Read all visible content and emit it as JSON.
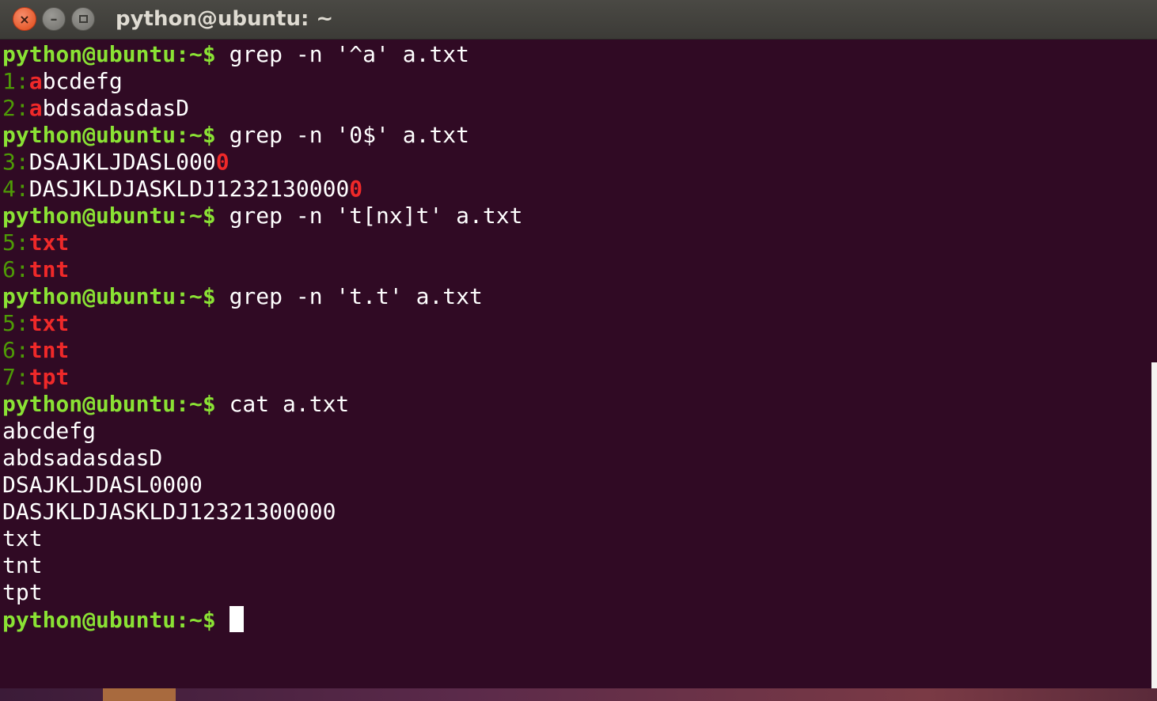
{
  "window": {
    "title": "python@ubuntu: ~",
    "close_glyph": "×",
    "minimize_glyph": "–"
  },
  "prompt": "python@ubuntu:~$",
  "lines": [
    {
      "type": "cmd",
      "cmd": " grep -n '^a' a.txt"
    },
    {
      "type": "match",
      "num": "1",
      "pre": "",
      "m": "a",
      "post": "bcdefg"
    },
    {
      "type": "match",
      "num": "2",
      "pre": "",
      "m": "a",
      "post": "bdsadasdasD"
    },
    {
      "type": "cmd",
      "cmd": " grep -n '0$' a.txt"
    },
    {
      "type": "match",
      "num": "3",
      "pre": "DSAJKLJDASL000",
      "m": "0",
      "post": ""
    },
    {
      "type": "match",
      "num": "4",
      "pre": "DASJKLDJASKLDJ1232130000",
      "m": "0",
      "post": ""
    },
    {
      "type": "cmd",
      "cmd": " grep -n 't[nx]t' a.txt"
    },
    {
      "type": "match",
      "num": "5",
      "pre": "",
      "m": "txt",
      "post": ""
    },
    {
      "type": "match",
      "num": "6",
      "pre": "",
      "m": "tnt",
      "post": ""
    },
    {
      "type": "cmd",
      "cmd": " grep -n 't.t' a.txt"
    },
    {
      "type": "match",
      "num": "5",
      "pre": "",
      "m": "txt",
      "post": ""
    },
    {
      "type": "match",
      "num": "6",
      "pre": "",
      "m": "tnt",
      "post": ""
    },
    {
      "type": "match",
      "num": "7",
      "pre": "",
      "m": "tpt",
      "post": ""
    },
    {
      "type": "cmd",
      "cmd": " cat a.txt"
    },
    {
      "type": "out",
      "text": "abcdefg"
    },
    {
      "type": "out",
      "text": "abdsadasdasD"
    },
    {
      "type": "out",
      "text": "DSAJKLJDASL0000"
    },
    {
      "type": "out",
      "text": "DASJKLDJASKLDJ12321300000"
    },
    {
      "type": "out",
      "text": "txt"
    },
    {
      "type": "out",
      "text": "tnt"
    },
    {
      "type": "out",
      "text": "tpt"
    },
    {
      "type": "active",
      "cmd": " "
    }
  ],
  "colors": {
    "background": "#300a24",
    "prompt": "#8ae234",
    "line_number": "#4e9a06",
    "match": "#ef2929",
    "text": "#ffffff"
  }
}
